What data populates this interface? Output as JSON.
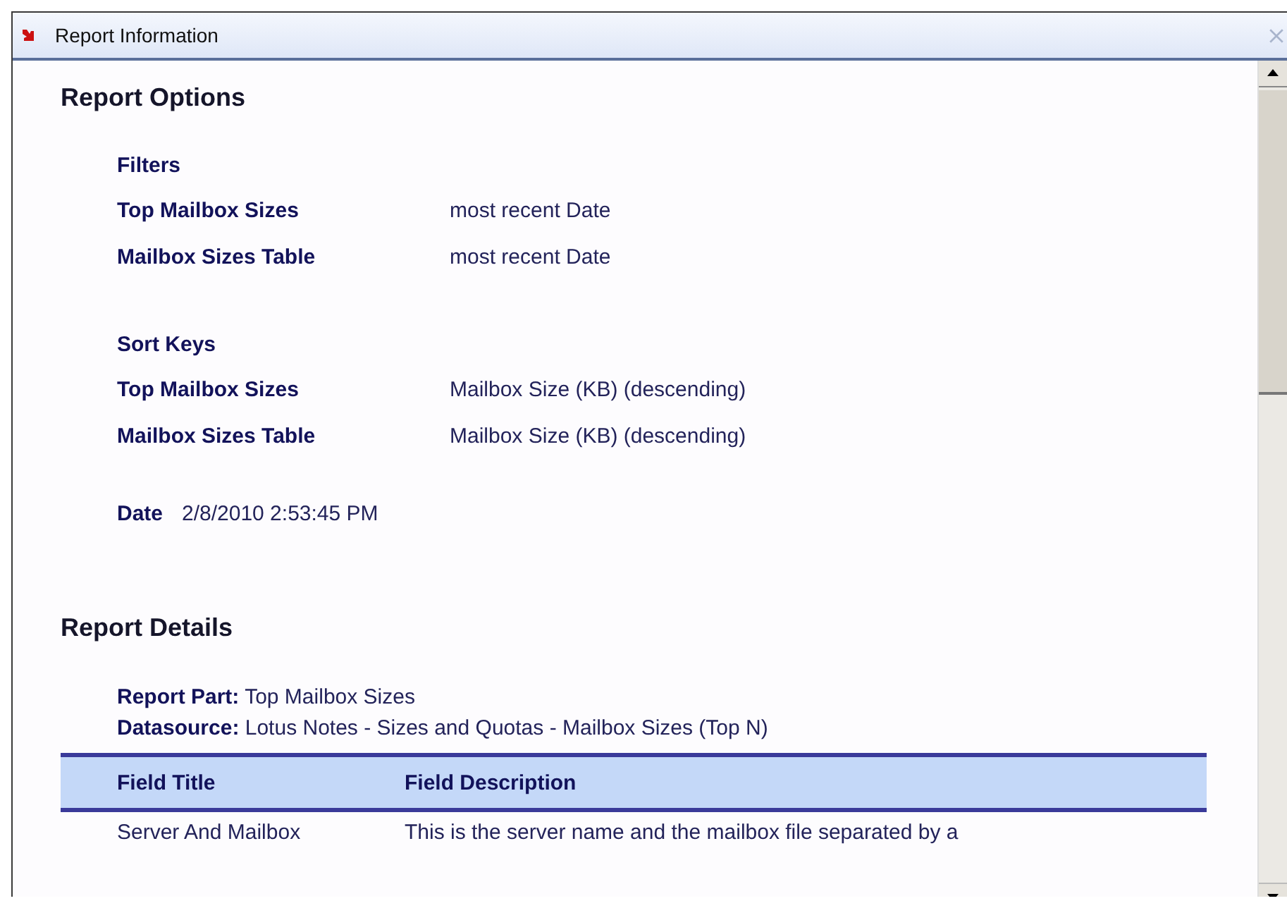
{
  "window": {
    "title": "Report Information"
  },
  "report_options": {
    "heading": "Report Options",
    "filters": {
      "heading": "Filters",
      "rows": [
        {
          "label": "Top Mailbox Sizes",
          "value": "most recent Date"
        },
        {
          "label": "Mailbox Sizes Table",
          "value": "most recent Date"
        }
      ]
    },
    "sort_keys": {
      "heading": "Sort Keys",
      "rows": [
        {
          "label": "Top Mailbox Sizes",
          "value": "Mailbox Size (KB) (descending)"
        },
        {
          "label": "Mailbox Sizes Table",
          "value": "Mailbox Size (KB) (descending)"
        }
      ]
    },
    "date": {
      "label": "Date",
      "value": "2/8/2010 2:53:45 PM"
    }
  },
  "report_details": {
    "heading": "Report Details",
    "info": [
      "**Report Part:** Top Mailbox Sizes",
      "**Datasource:** Lotus Notes - Sizes and Quotas - Mailbox Sizes (Top N)"
    ],
    "table": {
      "columns": [
        "Field Title",
        "Field Description"
      ],
      "rows": [
        [
          "Server And Mailbox",
          "This is the server name and the mailbox file separated by a"
        ]
      ]
    }
  }
}
